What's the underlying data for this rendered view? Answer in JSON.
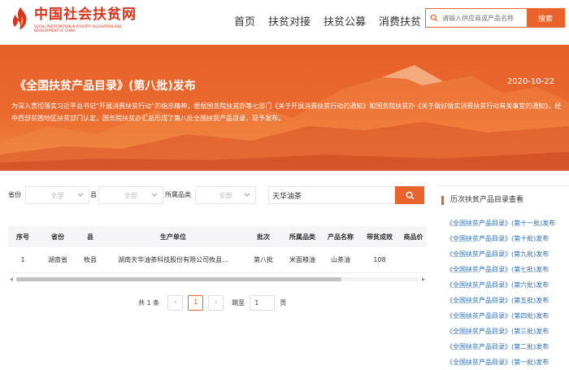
{
  "header": {
    "logo_title": "中国社会扶贫网",
    "logo_sub": "SOCIAL PARTICIPATION IN POVERTY ALLEVIATION AND DEVELOPMENT OF CHINA",
    "nav": [
      "首页",
      "扶贫对接",
      "扶贫公募",
      "消费扶贫"
    ],
    "search_placeholder": "请输入供应商或产品名称",
    "search_button": "搜索"
  },
  "banner": {
    "title": "《全国扶贫产品目录》(第八批)发布",
    "date": "2020-10-22",
    "desc": "为深入贯彻落实习近平总书记“开展消费扶贫行动”的指示精神，根据国务院扶贫办等七部门《关于开展消费扶贫行动的通知》和国务院扶贫办《关于做好做实消费扶贫行动有关事宜的通知》，经中西部贫困地区扶贫部门认定，国务院扶贫办汇总形成了第八批全国扶贫产品目录，现予发布。"
  },
  "filters": {
    "province_label": "省份",
    "province_value": "全部",
    "county_label": "县",
    "county_value": "全部",
    "category_label": "所属品类",
    "category_value": "全部",
    "search_value": "天华油茶"
  },
  "table": {
    "headers": [
      "序号",
      "省份",
      "县",
      "生产单位",
      "批次",
      "所属品类",
      "产品名称",
      "带贫成效",
      "商品价"
    ],
    "rows": [
      [
        "1",
        "湖南省",
        "攸县",
        "湖南天华油茶科技股份有限公司攸县...",
        "第八批",
        "米面粮油",
        "山茶油",
        "108",
        ""
      ]
    ]
  },
  "pager": {
    "total": "共 1 条",
    "prev": "‹",
    "current": "1",
    "next": "›",
    "jump_label": "跳至",
    "jump_value": "1",
    "page_unit": "页"
  },
  "sidebar": {
    "title": "历次扶贫产品目录查看",
    "items": [
      "《全国扶贫产品目录》(第十一批)发布",
      "《全国扶贫产品目录》(第十批)发布",
      "《全国扶贫产品目录》(第九批)发布",
      "《全国扶贫产品目录》(第七批)发布",
      "《全国扶贫产品目录》(第六批)发布",
      "《全国扶贫产品目录》(第五批)发布",
      "《全国扶贫产品目录》(第四批)发布",
      "《全国扶贫产品目录》(第三批)发布",
      "《全国扶贫产品目录》(第二批)发布",
      "《全国扶贫产品目录》(第一批)发布"
    ]
  },
  "colors": {
    "accent": "#e8642c",
    "brand_red": "#d9341c",
    "link_blue": "#2a6ebb"
  }
}
